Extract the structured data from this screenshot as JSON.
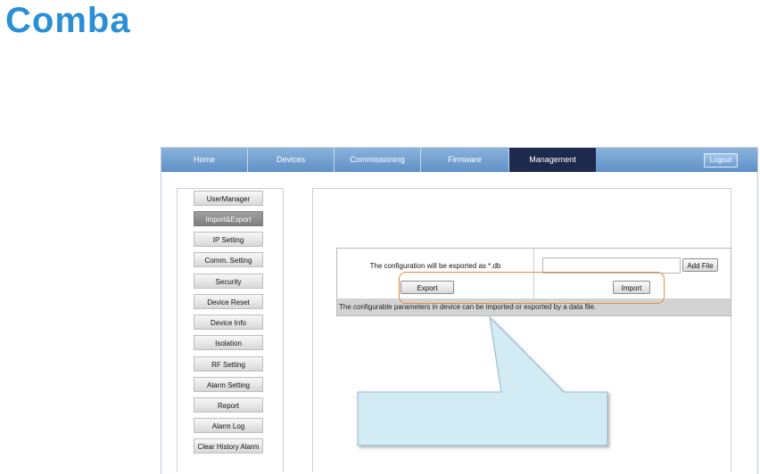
{
  "brand": {
    "logo_text": "Comba",
    "logo_color": "#2b8fd6"
  },
  "nav": {
    "tabs": [
      "Home",
      "Devices",
      "Commissioning",
      "Firmware",
      "Management"
    ],
    "active_tab": "Management",
    "logout_label": "Logout"
  },
  "sidebar": {
    "items": [
      "UserManager",
      "Import&Export",
      "IP Setting",
      "Comm. Setting",
      "Security",
      "Device Reset",
      "Device Info",
      "Isolation",
      "RF Setting",
      "Alarm Setting",
      "Report",
      "Alarm Log",
      "Clear History Alarm"
    ],
    "active_item": "Import&Export"
  },
  "import_export": {
    "export_text": "The configuration will be exported as *.db",
    "export_button": "Export",
    "file_value": "",
    "add_file_button": "Add File",
    "import_button": "Import",
    "description": "The configurable parameters in device can be imported or exported by a data file."
  },
  "colors": {
    "highlight": "#e88a3a",
    "callout_fill": "#d2ebf5",
    "nav_active": "#1e2a4d"
  }
}
